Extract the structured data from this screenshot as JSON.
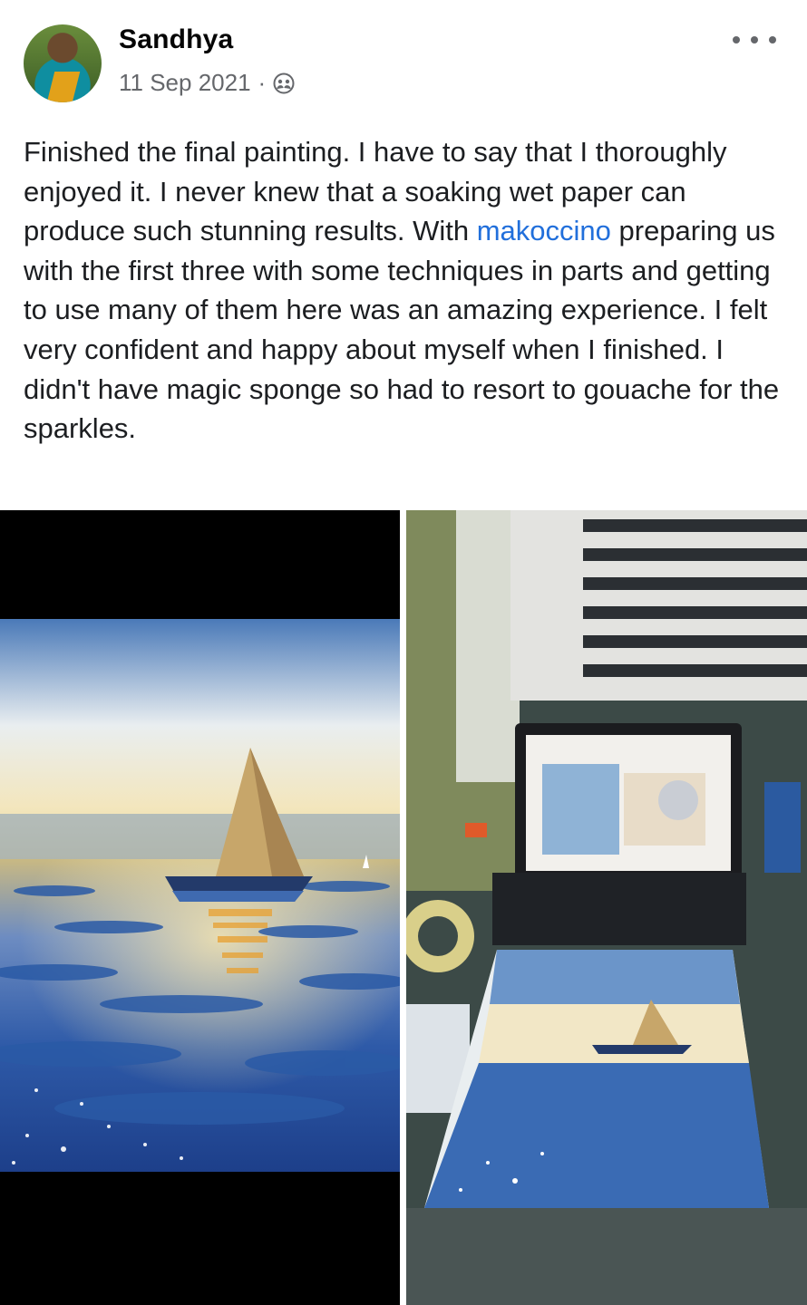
{
  "post": {
    "author": "Sandhya",
    "date": "11 Sep 2021",
    "separator": "·",
    "audience_icon": "friends-icon",
    "more_icon": "more-options-icon",
    "text_before_mention": "Finished the final painting. I have to say that I thoroughly enjoyed it. I never knew that a soaking wet paper can produce such stunning results. With ",
    "mention": "makoccino",
    "text_after_mention": " preparing us with the first three with some techniques in parts and getting to use many of them here was an amazing experience. I felt very confident and happy about myself when I finished. I didn't have magic sponge so had to resort to gouache for the sparkles."
  },
  "photos": [
    {
      "name": "painting-closeup-photo"
    },
    {
      "name": "desk-setup-photo"
    }
  ],
  "colors": {
    "text": "#1c1e21",
    "secondary": "#65676b",
    "link": "#216fdb"
  }
}
